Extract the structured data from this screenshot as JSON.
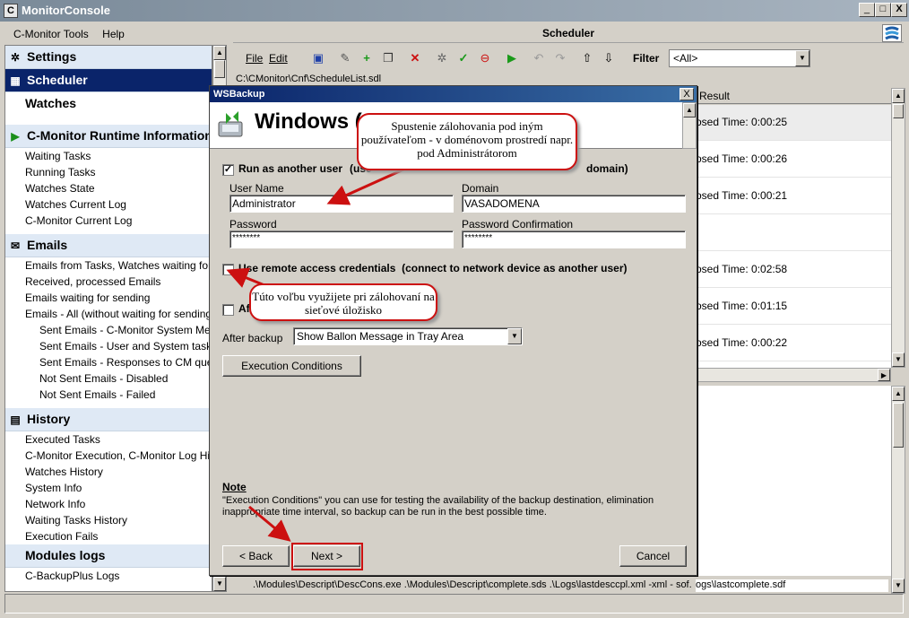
{
  "app": {
    "title": "MonitorConsole",
    "icon_letter": "C"
  },
  "window_controls": [
    "_",
    "□",
    "X"
  ],
  "menu": [
    "C-Monitor Tools",
    "Help"
  ],
  "sidebar": {
    "sections": [
      {
        "label": "Settings",
        "icon": "gear-icon",
        "items": []
      },
      {
        "label": "Scheduler",
        "icon": "scheduler-icon",
        "active": true,
        "items": []
      },
      {
        "label": "Watches",
        "icon": "",
        "items": []
      },
      {
        "label": "C-Monitor Runtime Information",
        "icon": "play-icon",
        "items": [
          "Waiting Tasks",
          "Running Tasks",
          "Watches State",
          "Watches Current Log",
          "C-Monitor Current Log"
        ]
      },
      {
        "label": "Emails",
        "icon": "envelope-icon",
        "items": [
          "Emails from Tasks, Watches waiting for sending",
          "Received, processed Emails",
          "Emails waiting for sending",
          "Emails - All (without waiting for sending)"
        ],
        "subitems": [
          "Sent Emails - C-Monitor System Messages",
          "Sent Emails - User and System tasks Reports",
          "Sent Emails - Responses to CM queries",
          "Not Sent Emails - Disabled",
          "Not Sent Emails - Failed"
        ]
      },
      {
        "label": "History",
        "icon": "history-icon",
        "items": [
          "Executed Tasks",
          "C-Monitor Execution, C-Monitor Log History",
          "Watches History",
          "System Info",
          "Network Info",
          "Waiting Tasks History",
          "Execution Fails"
        ]
      },
      {
        "label": "Modules logs",
        "icon": "",
        "items": [
          "C-BackupPlus Logs"
        ]
      }
    ]
  },
  "right_panel": {
    "title": "Scheduler",
    "menu": [
      "File",
      "Edit"
    ],
    "filter_label": "Filter",
    "filter_value": "<All>",
    "path": "C:\\CMonitor\\Cnf\\ScheduleList.sdl",
    "result_header": "Result",
    "rows": [
      "osed Time: 0:00:25",
      "osed Time: 0:00:26",
      "osed Time: 0:00:21",
      "",
      "osed Time: 0:02:58",
      "osed Time: 0:01:15",
      "osed Time: 0:00:22",
      ""
    ],
    "bottom_cmd_left": ".\\Modules\\Descript\\DescCons.exe .\\Modules\\Descript\\complete.sds .\\Logs\\lastdesccpl.xml -xml - sof.",
    "bottom_cmd_right": "ogs\\lastcomplete.sdf"
  },
  "dialog": {
    "title": "WSBackup",
    "close_label": "X",
    "header_title": "Windows (",
    "run_as_label": "Run as another user",
    "run_as_prefix": "(use",
    "run_as_suffix": "domain)",
    "run_as_checked": true,
    "username_label": "User Name",
    "username_value": "Administrator",
    "domain_label": "Domain",
    "domain_value": "VASADOMENA",
    "password_label": "Password",
    "password_value": "********",
    "password_confirm_label": "Password Confirmation",
    "password_confirm_value": "********",
    "remote_label": "Use remote access credentials",
    "remote_desc": "(connect to network device as another user)",
    "remote_checked": false,
    "third_check_label": "Af",
    "after_backup_label": "After backup",
    "after_backup_value": "Show Ballon Message in Tray Area",
    "exec_cond_button": "Execution Conditions",
    "note_title": "Note",
    "note_text": "\"Execution Conditions\" you can use for testing the availability of the backup destination, elimination inappropriate time interval, so backup can be run in the best possible time.",
    "back_button": "< Back",
    "next_button": "Next >",
    "cancel_button": "Cancel"
  },
  "callouts": {
    "top": "Spustenie zálohovania pod iným používateľom - v doménovom prostredí napr. pod Administrátorom",
    "mid": "Túto voľbu využijete pri zálohovaní na sieťové úložisko"
  },
  "colors": {
    "annotation_red": "#cc1010",
    "active_section": "#0a246a",
    "section_bg": "#dfe9f5"
  }
}
